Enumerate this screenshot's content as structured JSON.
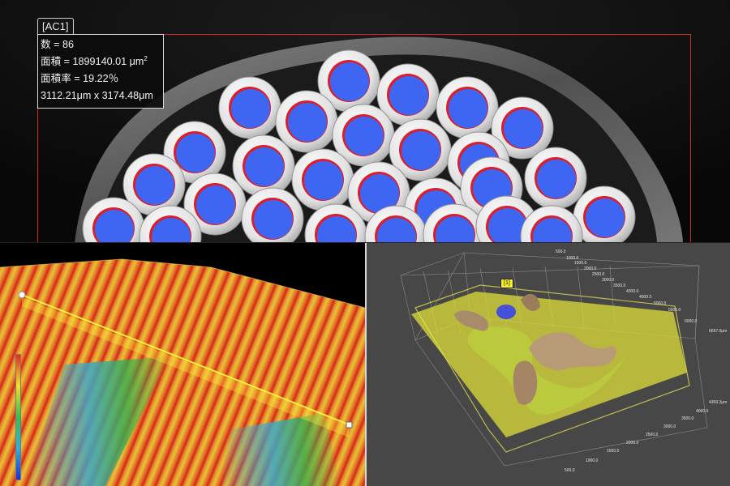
{
  "top_view": {
    "roi_label": "[AC1]",
    "stats": {
      "count": {
        "label": "数",
        "value": "86"
      },
      "area": {
        "label": "面積",
        "value": "1899140.01",
        "unit": "μm",
        "unit_sup": "2"
      },
      "area_ratio": {
        "label": "面積率",
        "value": "19.22％"
      },
      "dimensions": "3112.21μm x 3174.48μm"
    },
    "colors": {
      "detected_fill": "#3f66f2",
      "edge_highlight": "#dc1e28",
      "roi_frame": "#d1262a",
      "fiber_ring": "#eaeaea"
    }
  },
  "left_view": {
    "scale_ticks": [
      "",
      "",
      "",
      "",
      ""
    ],
    "colors": {
      "high": "#d9241e",
      "mid": "#e6b92c",
      "low_green": "#35b04b",
      "low_cyan": "#3f9fcf",
      "profile_line": "#fff23a"
    }
  },
  "right_view": {
    "marker_label": "[1]",
    "axis_top": [
      "500.0",
      "1000.0",
      "1500.0",
      "2000.0",
      "2500.0",
      "3000.0",
      "3500.0",
      "4000.0",
      "4500.0",
      "5000.0",
      "5500.0",
      "6000.0",
      "6697.0μm"
    ],
    "axis_bottom": [
      "4369.2μm",
      "4000.0",
      "3500.0",
      "3000.0",
      "2500.0",
      "2000.0",
      "1500.0",
      "1000.0",
      "500.0"
    ],
    "colors": {
      "plate": "#d9d83a",
      "background": "#474747",
      "blob": "#4451d4",
      "ridge": "#a88b6a"
    }
  }
}
